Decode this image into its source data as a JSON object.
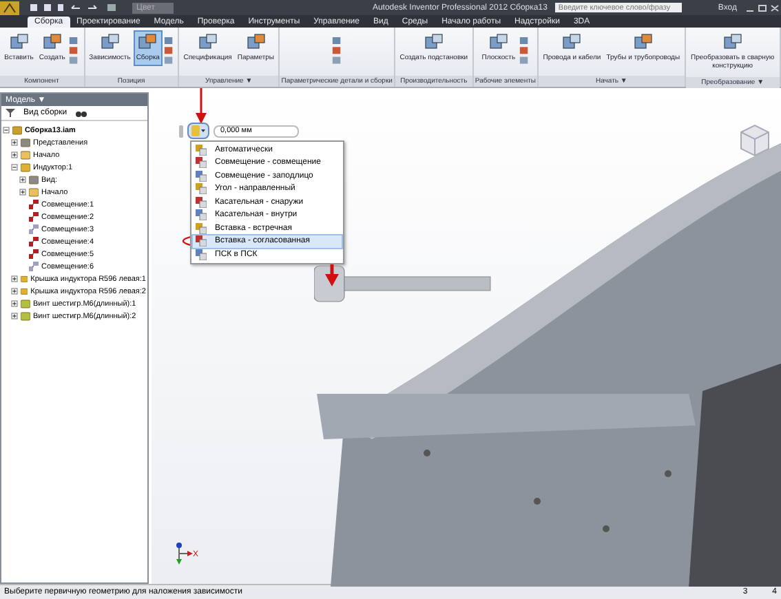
{
  "window": {
    "title": "Autodesk Inventor Professional 2012   Сборка13",
    "style_box": "Цвет",
    "search": {
      "placeholder": "Введите ключевое слово/фразу"
    },
    "sign_in": "Вход"
  },
  "tabs": [
    {
      "label": "Сборка",
      "selected": true
    },
    {
      "label": "Проектирование",
      "selected": false
    },
    {
      "label": "Модель",
      "selected": false
    },
    {
      "label": "Проверка",
      "selected": false
    },
    {
      "label": "Инструменты",
      "selected": false
    },
    {
      "label": "Управление",
      "selected": false
    },
    {
      "label": "Вид",
      "selected": false
    },
    {
      "label": "Среды",
      "selected": false
    },
    {
      "label": "Начало работы",
      "selected": false
    },
    {
      "label": "Надстройки",
      "selected": false
    },
    {
      "label": "3DA",
      "selected": false
    }
  ],
  "ribbon": [
    {
      "label": "Компонент",
      "items": [
        {
          "kind": "large",
          "label": "Вставить",
          "selected": false
        },
        {
          "kind": "large",
          "label": "Создать",
          "selected": false
        },
        {
          "kind": "small"
        }
      ]
    },
    {
      "label": "Позиция",
      "items": [
        {
          "kind": "large",
          "label": "Зависимость",
          "selected": false
        },
        {
          "kind": "large",
          "label": "Сборка",
          "selected": true
        },
        {
          "kind": "small"
        }
      ]
    },
    {
      "label": "Управление ▼",
      "items": [
        {
          "kind": "large",
          "label": "Спецификация",
          "selected": false
        },
        {
          "kind": "large",
          "label": "Параметры",
          "selected": false
        }
      ]
    },
    {
      "label": "Параметрические детали и сборки",
      "items": [
        {
          "kind": "small"
        }
      ]
    },
    {
      "label": "Производительность",
      "items": [
        {
          "kind": "large",
          "label": "Создать подстановки",
          "selected": false
        }
      ]
    },
    {
      "label": "Рабочие элементы",
      "items": [
        {
          "kind": "large",
          "label": "Плоскость",
          "selected": false
        },
        {
          "kind": "small"
        }
      ]
    },
    {
      "label": "Начать ▼",
      "items": [
        {
          "kind": "large",
          "label": "Провода и кабели",
          "selected": false
        },
        {
          "kind": "large",
          "label": "Трубы и трубопроводы",
          "selected": false
        }
      ]
    },
    {
      "label": "Преобразование ▼",
      "items": [
        {
          "kind": "large",
          "label": "Преобразовать в сварную конструкцию",
          "selected": false
        }
      ]
    }
  ],
  "browser": {
    "title": "Модель ▼",
    "view": "Вид сборки",
    "tree": [
      {
        "label": "Сборка13.iam",
        "kind": "assembly",
        "expanded": true,
        "children": [
          {
            "label": "Представления",
            "kind": "views",
            "expanded": false
          },
          {
            "label": "Начало",
            "kind": "folder",
            "expanded": false
          },
          {
            "label": "Индуктор:1",
            "kind": "part",
            "expanded": true,
            "children": [
              {
                "label": "Вид:",
                "kind": "views",
                "expanded": false
              },
              {
                "label": "Начало",
                "kind": "folder",
                "expanded": false
              },
              {
                "label": "Совмещение:1",
                "kind": "constraint"
              },
              {
                "label": "Совмещение:2",
                "kind": "constraint"
              },
              {
                "label": "Совмещение:3",
                "kind": "constraint_off"
              },
              {
                "label": "Совмещение:4",
                "kind": "constraint"
              },
              {
                "label": "Совмещение:5",
                "kind": "constraint"
              },
              {
                "label": "Совмещение:6",
                "kind": "constraint_off"
              }
            ]
          },
          {
            "label": "Крышка индуктора R596 левая:1",
            "kind": "part",
            "expanded": false
          },
          {
            "label": "Крышка индуктора R596 левая:2",
            "kind": "part",
            "expanded": false
          },
          {
            "label": "Винт шестигр.M6(длинный):1",
            "kind": "screw",
            "expanded": false
          },
          {
            "label": "Винт шестигр.M6(длинный):2",
            "kind": "screw",
            "expanded": false
          }
        ]
      }
    ]
  },
  "constraint_menu": {
    "value": "0,000 мм",
    "items": [
      {
        "label": "Автоматически",
        "selected": false
      },
      {
        "label": "Совмещение - совмещение",
        "selected": false
      },
      {
        "label": "Совмещение - заподлицо",
        "selected": false
      },
      {
        "label": "Угол - направленный",
        "selected": false
      },
      {
        "label": "Касательная - снаружи",
        "selected": false
      },
      {
        "label": "Касательная - внутри",
        "selected": false
      },
      {
        "label": "Вставка - встречная",
        "selected": false
      },
      {
        "label": "Вставка - согласованная",
        "selected": true
      },
      {
        "label": "ПСК в ПСК",
        "selected": false
      }
    ]
  },
  "axis_label": "X",
  "status_bar": {
    "message": "Выберите первичную геометрию для наложения зависимости",
    "counts": [
      "3",
      "4"
    ]
  }
}
